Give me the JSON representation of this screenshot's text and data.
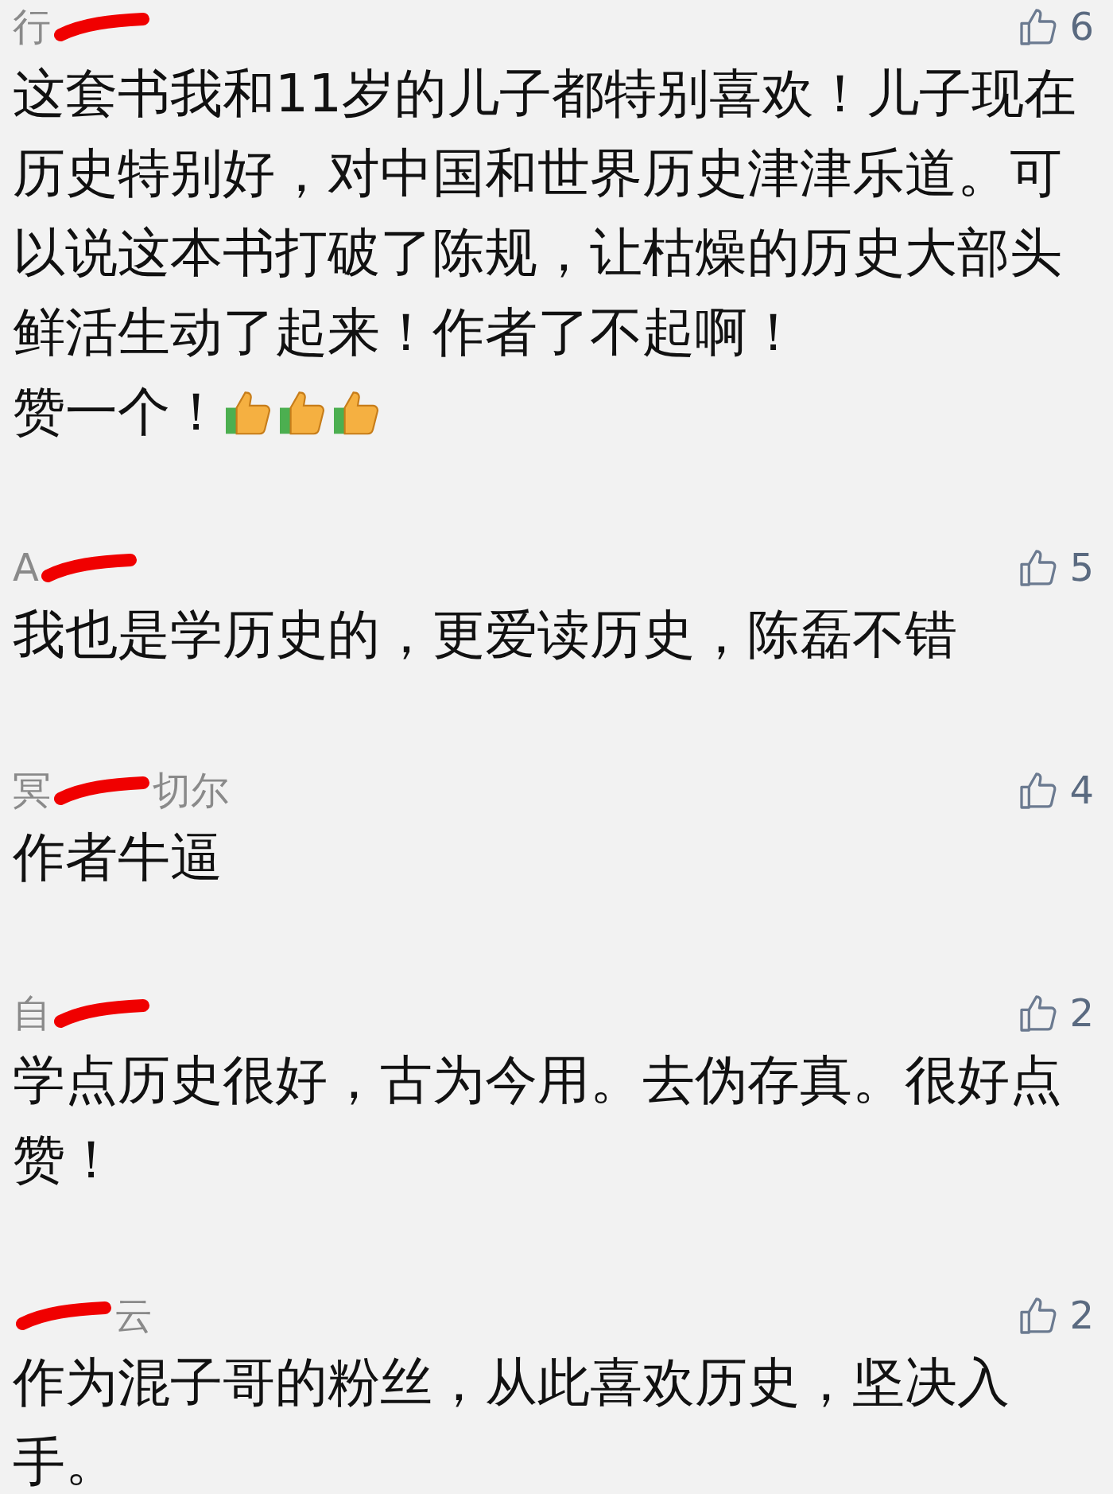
{
  "comments": [
    {
      "author_start": "行",
      "likes": "6",
      "text": "这套书我和11岁的儿子都特别喜欢！儿子现在历史特别好，对中国和世界历史津津乐道。可以说这本书打破了陈规，让枯燥的历史大部头鲜活生动了起来！作者了不起啊！",
      "text_end": "赞一个！",
      "emojis": [
        {
          "kind": "thumbs-up"
        },
        {
          "kind": "thumbs-up"
        },
        {
          "kind": "thumbs-up"
        }
      ]
    },
    {
      "author_start": "A",
      "likes": "5",
      "text": "我也是学历史的，更爱读历史，陈磊不错"
    },
    {
      "author_start": "冥",
      "author_end": "切尔",
      "likes": "4",
      "text": "作者牛逼"
    },
    {
      "author_start": "自",
      "likes": "2",
      "text": "学点历史很好，古为今用。去伪存真。很好点赞！"
    },
    {
      "author_end": "云",
      "likes": "2",
      "text": "作为混子哥的粉丝，从此喜欢历史，坚决入手。"
    }
  ]
}
